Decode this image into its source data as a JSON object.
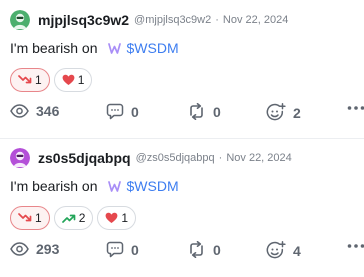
{
  "posts": [
    {
      "username": "mjpjlsq3c9w2",
      "handle": "@mjpjlsq3c9w2",
      "separator": "·",
      "date": "Nov 22, 2024",
      "text": "I'm bearish on",
      "cashtag": "$WSDM",
      "reactions": [
        {
          "type": "bearish",
          "count": "1",
          "active": true
        },
        {
          "type": "heart",
          "count": "1",
          "active": false
        }
      ],
      "stats": {
        "views": "346",
        "comments": "0",
        "reposts": "0",
        "reactions": "2"
      },
      "avatar_color": "#4caf6e"
    },
    {
      "username": "zs0s5djqabpq",
      "handle": "@zs0s5djqabpq",
      "separator": "·",
      "date": "Nov 22, 2024",
      "text": "I'm bearish on",
      "cashtag": "$WSDM",
      "reactions": [
        {
          "type": "bearish",
          "count": "1",
          "active": true
        },
        {
          "type": "bullish",
          "count": "2",
          "active": false
        },
        {
          "type": "heart",
          "count": "1",
          "active": false
        }
      ],
      "stats": {
        "views": "293",
        "comments": "0",
        "reposts": "0",
        "reactions": "4"
      },
      "avatar_color": "#b44fd8"
    }
  ],
  "colors": {
    "bearish": "#e5484d",
    "bullish": "#22a559",
    "heart": "#e5484d",
    "cashtag": "#3d7df0",
    "wsdm_logo": "#a98ef7"
  },
  "icons": [
    "eye-icon",
    "comment-icon",
    "repost-icon",
    "add-reaction-icon",
    "more-icon",
    "trend-down-icon",
    "trend-up-icon",
    "heart-icon",
    "wsdm-logo-icon"
  ]
}
